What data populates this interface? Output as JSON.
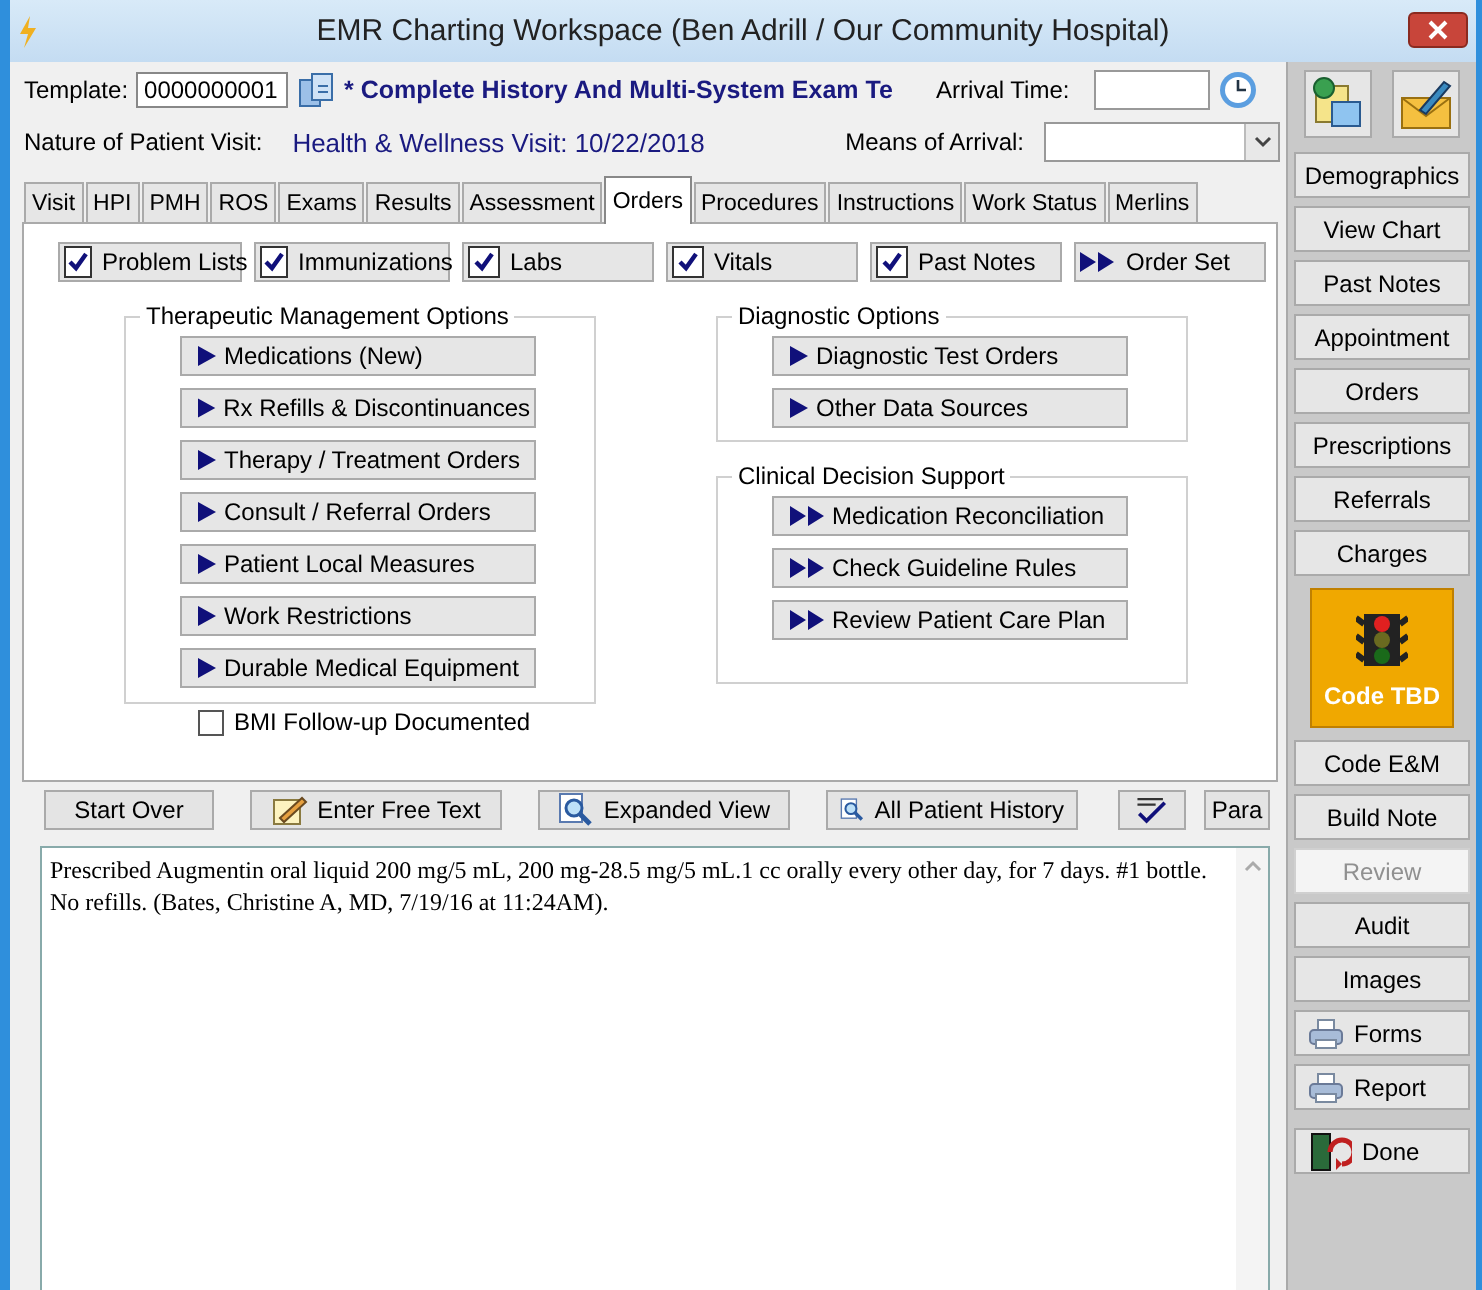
{
  "window": {
    "title": "EMR Charting Workspace (Ben Adrill / Our Community Hospital)"
  },
  "header": {
    "template_label": "Template:",
    "template_value": "0000000001",
    "template_name": "* Complete History And Multi-System Exam Te",
    "arrival_time_label": "Arrival Time:",
    "nature_label": "Nature of Patient Visit:",
    "nature_value": "Health & Wellness Visit: 10/22/2018",
    "means_label": "Means of Arrival:"
  },
  "tabs": [
    {
      "label": "Visit",
      "selected": false
    },
    {
      "label": "HPI",
      "selected": false
    },
    {
      "label": "PMH",
      "selected": false
    },
    {
      "label": "ROS",
      "selected": false
    },
    {
      "label": "Exams",
      "selected": false
    },
    {
      "label": "Results",
      "selected": false
    },
    {
      "label": "Assessment",
      "selected": false
    },
    {
      "label": "Orders",
      "selected": true
    },
    {
      "label": "Procedures",
      "selected": false
    },
    {
      "label": "Instructions",
      "selected": false
    },
    {
      "label": "Work Status",
      "selected": false
    },
    {
      "label": "Merlins",
      "selected": false
    }
  ],
  "toggles": [
    {
      "kind": "check",
      "label": "Problem Lists",
      "checked": true
    },
    {
      "kind": "check",
      "label": "Immunizations",
      "checked": true
    },
    {
      "kind": "check",
      "label": "Labs",
      "checked": true
    },
    {
      "kind": "check",
      "label": "Vitals",
      "checked": true
    },
    {
      "kind": "check",
      "label": "Past Notes",
      "checked": true
    },
    {
      "kind": "action",
      "label": "Order Set"
    }
  ],
  "therapeutic": {
    "title": "Therapeutic Management Options",
    "items": [
      {
        "kind": "single",
        "label": "Medications (New)"
      },
      {
        "kind": "single",
        "label": "Rx Refills & Discontinuances"
      },
      {
        "kind": "single",
        "label": "Therapy / Treatment Orders"
      },
      {
        "kind": "single",
        "label": "Consult / Referral Orders"
      },
      {
        "kind": "single",
        "label": "Patient Local Measures"
      },
      {
        "kind": "single",
        "label": "Work Restrictions"
      },
      {
        "kind": "single",
        "label": "Durable Medical Equipment"
      }
    ]
  },
  "diagnostic": {
    "title": "Diagnostic Options",
    "items": [
      {
        "kind": "single",
        "label": "Diagnostic Test Orders"
      },
      {
        "kind": "single",
        "label": "Other Data Sources"
      }
    ]
  },
  "decision_support": {
    "title": "Clinical Decision Support",
    "items": [
      {
        "kind": "double",
        "label": "Medication Reconciliation"
      },
      {
        "kind": "double",
        "label": "Check Guideline Rules"
      },
      {
        "kind": "double",
        "label": "Review Patient Care Plan"
      }
    ]
  },
  "bmi": {
    "label": "BMI Follow-up Documented",
    "checked": false
  },
  "actions": [
    {
      "kind": "plain",
      "label": "Start Over"
    },
    {
      "kind": "pencil",
      "label": "Enter Free Text"
    },
    {
      "kind": "magnifier",
      "label": "Expanded View"
    },
    {
      "kind": "magnifier",
      "label": "All Patient History"
    },
    {
      "kind": "spell"
    },
    {
      "kind": "plain",
      "label": "Para"
    }
  ],
  "note": "Prescribed Augmentin oral liquid 200 mg/5 mL, 200 mg-28.5 mg/5 mL.1 cc orally every other day, for 7 days. #1 bottle. No refills. (Bates, Christine A, MD,  7/19/16 at 11:24AM).",
  "sidebar": [
    {
      "kind": "plain",
      "label": "Demographics",
      "disabled": false
    },
    {
      "kind": "plain",
      "label": "View Chart",
      "disabled": false
    },
    {
      "kind": "plain",
      "label": "Past Notes",
      "disabled": false
    },
    {
      "kind": "plain",
      "label": "Appointment",
      "disabled": false
    },
    {
      "kind": "plain",
      "label": "Orders",
      "disabled": false
    },
    {
      "kind": "plain",
      "label": "Prescriptions",
      "disabled": false
    },
    {
      "kind": "plain",
      "label": "Referrals",
      "disabled": false
    },
    {
      "kind": "plain",
      "label": "Charges",
      "disabled": false
    },
    {
      "kind": "status",
      "label": "Code TBD",
      "disabled": false
    },
    {
      "kind": "plain",
      "label": "Code E&M",
      "disabled": false
    },
    {
      "kind": "plain",
      "label": "Build Note",
      "disabled": false
    },
    {
      "kind": "plain",
      "label": "Review",
      "disabled": true
    },
    {
      "kind": "plain",
      "label": "Audit",
      "disabled": false
    },
    {
      "kind": "plain",
      "label": "Images",
      "disabled": false
    },
    {
      "kind": "printer",
      "label": "Forms",
      "disabled": false
    },
    {
      "kind": "printer",
      "label": "Report",
      "disabled": false
    },
    {
      "kind": "door",
      "label": "Done",
      "disabled": false
    }
  ]
}
